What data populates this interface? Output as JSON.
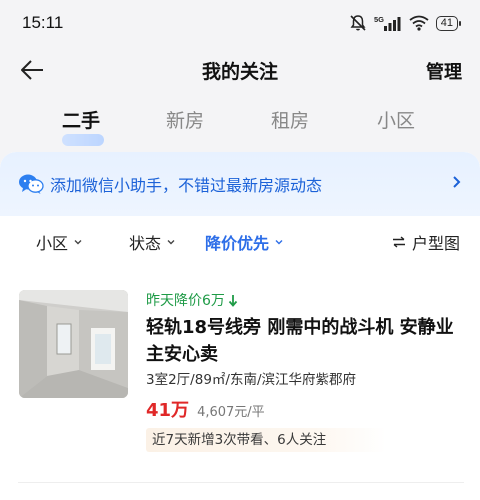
{
  "status_bar": {
    "time": "15:11",
    "network": "5G",
    "battery": "41",
    "icons": [
      "mute-bell-icon",
      "signal-icon",
      "wifi-icon",
      "battery-icon"
    ]
  },
  "header": {
    "title": "我的关注",
    "manage_label": "管理",
    "back_icon": "arrow-left-icon"
  },
  "tabs": [
    {
      "label": "二手",
      "active": true
    },
    {
      "label": "新房",
      "active": false
    },
    {
      "label": "租房",
      "active": false
    },
    {
      "label": "小区",
      "active": false
    }
  ],
  "banner": {
    "text": "添加微信小助手，不错过最新房源动态",
    "icon": "wechat-icon"
  },
  "filters": [
    {
      "label": "小区",
      "active": false
    },
    {
      "label": "状态",
      "active": false
    },
    {
      "label": "降价优先",
      "active": true
    }
  ],
  "layout_button": {
    "label": "户型图",
    "icon": "swap-icon"
  },
  "listing": {
    "price_drop": "昨天降价6万",
    "title": "轻轨18号线旁 刚需中的战斗机 安静业主安心卖",
    "meta": "3室2厅/89㎡/东南/滨江华府紫郡府",
    "total_price": "41万",
    "unit_price": "4,607元/平",
    "tag": "近7天新增3次带看、6人关注"
  },
  "colors": {
    "accent_blue": "#2d6ee8",
    "price_red": "#e02828",
    "drop_green": "#1f9b47",
    "banner_text": "#1c62d8"
  }
}
